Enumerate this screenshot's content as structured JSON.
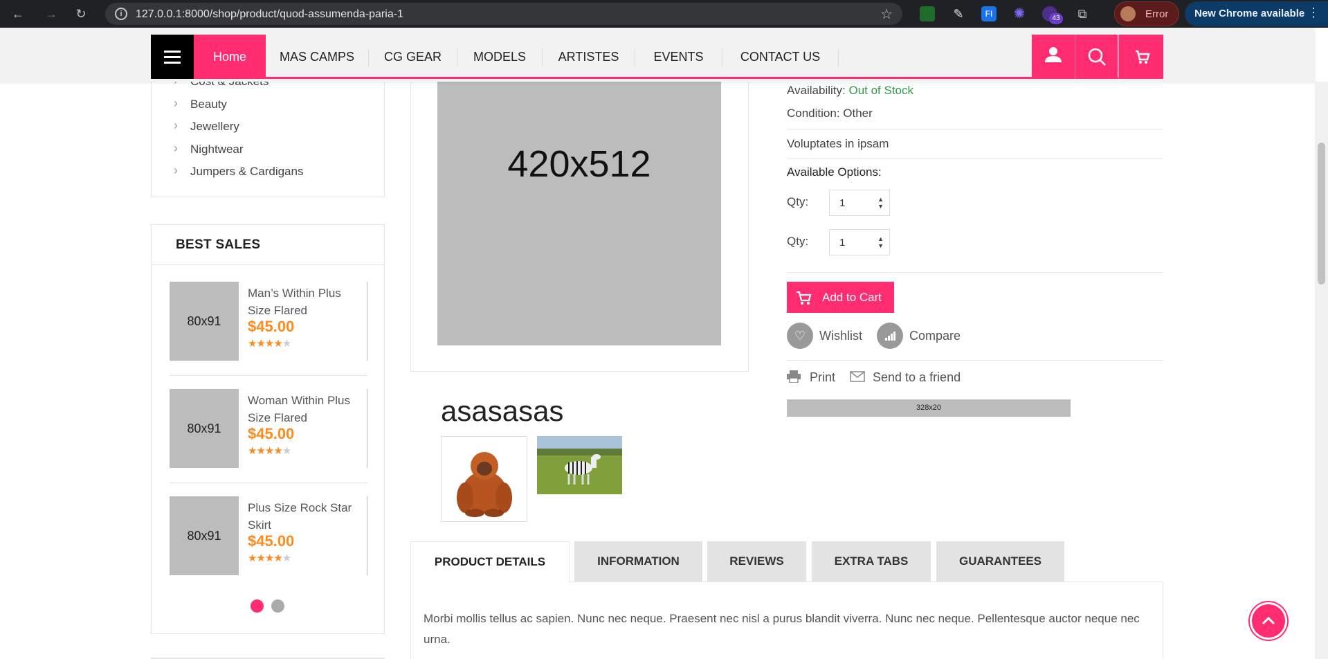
{
  "browser": {
    "url": "127.0.0.1:8000/shop/product/quod-assumenda-paria-1",
    "profile_label": "Error",
    "update_label": "New Chrome available",
    "extension_badge": "43"
  },
  "nav": {
    "home": "Home",
    "items": [
      "MAS CAMPS",
      "CG GEAR",
      "MODELS",
      "ARTISTES",
      "EVENTS",
      "CONTACT US"
    ]
  },
  "sidebar": {
    "categories": [
      "Cost & Jackets",
      "Beauty",
      "Jewellery",
      "Nightwear",
      "Jumpers & Cardigans"
    ],
    "best_sales": {
      "title": "BEST SALES",
      "items": [
        {
          "thumb": "80x91",
          "name": "Man’s Within Plus Size Flared",
          "price": "$45.00",
          "rating": 3.5
        },
        {
          "thumb": "80x91",
          "name": "Woman Within Plus Size Flared",
          "price": "$45.00",
          "rating": 3.5
        },
        {
          "thumb": "80x91",
          "name": "Plus Size Rock Star Skirt",
          "price": "$45.00",
          "rating": 3.5
        }
      ],
      "pages": 2,
      "active_page": 1
    }
  },
  "product": {
    "image_placeholder": "420x512",
    "title": "asasasas",
    "availability_label": "Availability:",
    "availability_value": "Out of Stock",
    "condition": "Condition: Other",
    "description_short": "Voluptates in ipsam",
    "options_label": "Available Options:",
    "qty_label": "Qty:",
    "qty_values": [
      "1",
      "1"
    ],
    "add_to_cart": "Add to Cart",
    "wishlist": "Wishlist",
    "compare": "Compare",
    "print": "Print",
    "send_friend": "Send to a friend",
    "banner_placeholder": "328x20"
  },
  "tabs": {
    "labels": [
      "PRODUCT DETAILS",
      "INFORMATION",
      "REVIEWS",
      "EXTRA TABS",
      "GUARANTEES"
    ],
    "active": "PRODUCT DETAILS",
    "content": "Morbi mollis tellus ac sapien. Nunc nec neque. Praesent nec nisl a purus blandit viverra. Nunc nec neque. Pellentesque auctor neque nec urna."
  },
  "colors": {
    "accent": "#ff2d6f",
    "price": "#ff8a1f",
    "in_stock_text": "#2e9a4a"
  }
}
